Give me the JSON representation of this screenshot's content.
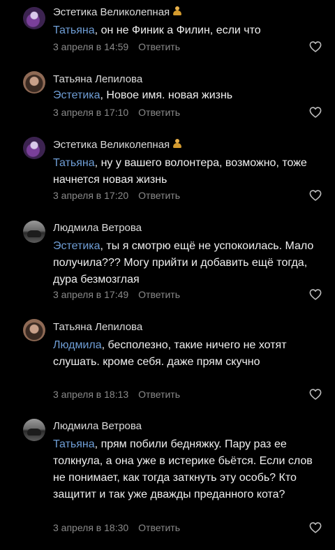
{
  "comments": [
    {
      "author": "Эстетика Великолепная",
      "mention": "Татьяна",
      "text": ", он не Финик а Филин, если что",
      "date": "3 апреля в 14:59",
      "reply": "Ответить"
    },
    {
      "author": "Татьяна Лепилова",
      "mention": "Эстетика",
      "text": ", Новое имя. новая жизнь",
      "date": "3 апреля в 17:10",
      "reply": "Ответить"
    },
    {
      "author": "Эстетика Великолепная",
      "mention": "Татьяна",
      "text": ", ну у вашего волонтера, возможно, тоже начнется новая жизнь",
      "date": "3 апреля в 17:20",
      "reply": "Ответить"
    },
    {
      "author": "Людмила Ветрова",
      "mention": "Эстетика",
      "text": ", ты я смотрю ещё не успокоилась. Мало получила??? Могу  прийти и добавить ещё тогда, дура безмозглая",
      "date": "3 апреля в 17:49",
      "reply": "Ответить"
    },
    {
      "author": "Татьяна Лепилова",
      "mention": "Людмила",
      "text": ", бесполезно, такие ничего не хотят слушать. кроме себя. даже прям скучно",
      "date": "3 апреля в 18:13",
      "reply": "Ответить"
    },
    {
      "author": "Людмила Ветрова",
      "mention": "Татьяна",
      "text": ", прям побили бедняжку. Пару раз ее толкнула, а она уже в истерике бьётся. Если слов не понимает, как тогда заткнуть эту особь? Кто защитит и так уже дважды преданного кота?",
      "date": "3 апреля в 18:30",
      "reply": "Ответить"
    }
  ],
  "icons": {
    "like": "heart-outline-icon",
    "badge": "person-emoji-icon"
  },
  "colors": {
    "background": "#000000",
    "mention": "#6f9ed6",
    "meta": "#8a8a8a"
  }
}
